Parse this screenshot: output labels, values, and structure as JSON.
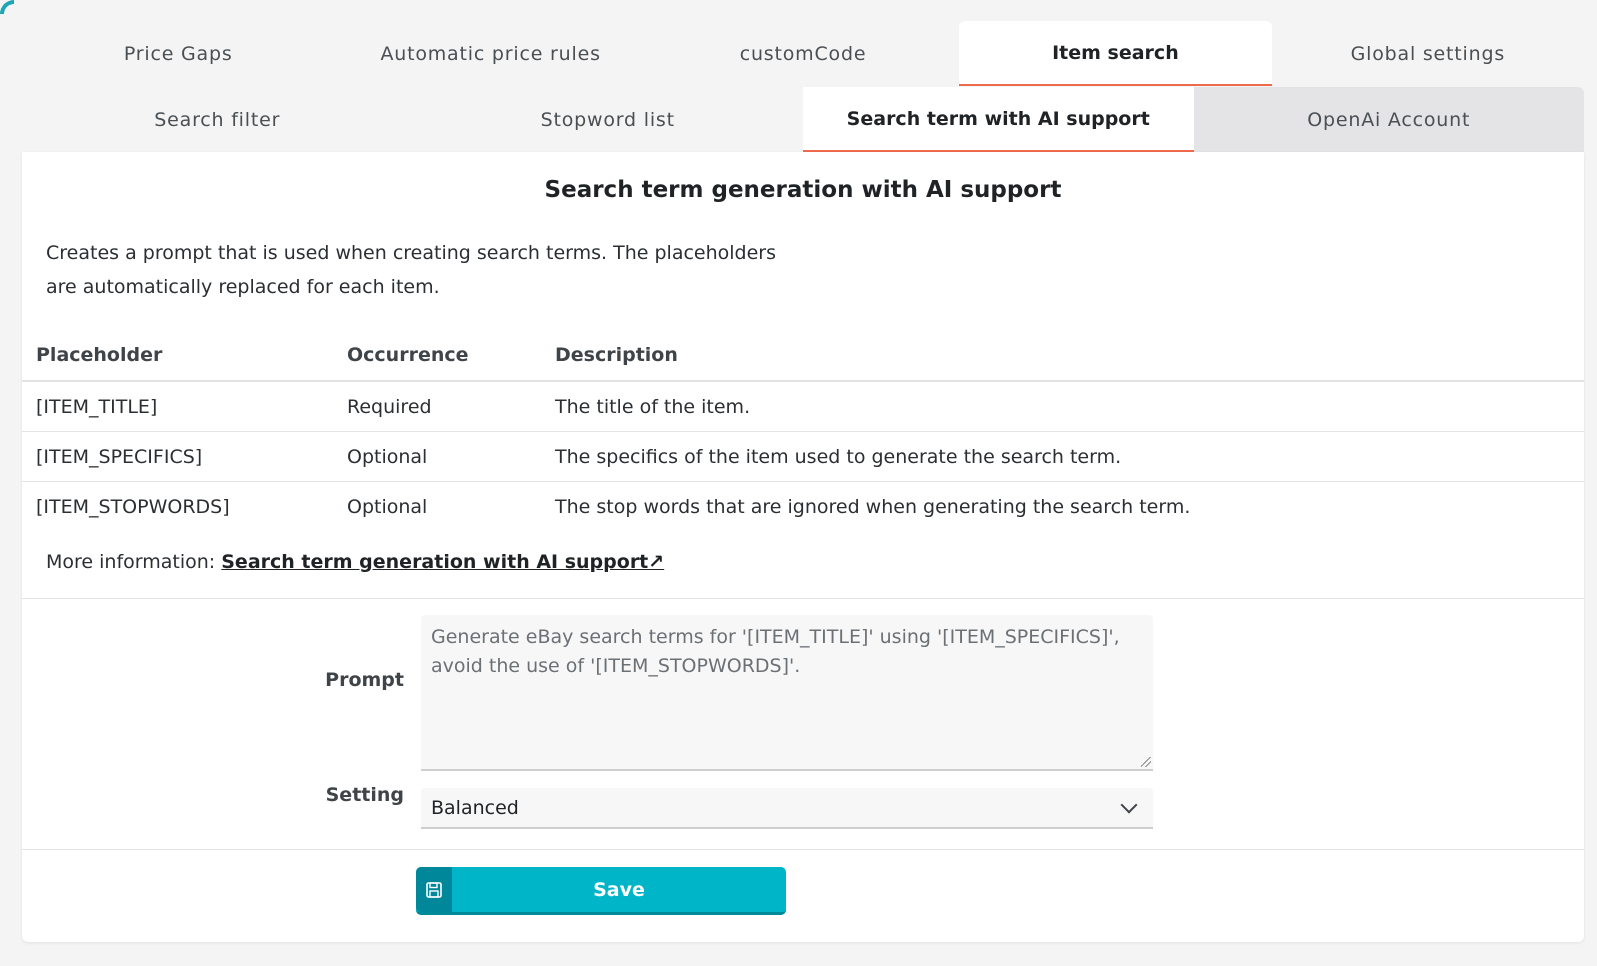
{
  "tabs_primary": [
    {
      "label": "Price Gaps",
      "active": false
    },
    {
      "label": "Automatic price rules",
      "active": false
    },
    {
      "label": "customCode",
      "active": false
    },
    {
      "label": "Item search",
      "active": true
    },
    {
      "label": "Global settings",
      "active": false
    }
  ],
  "tabs_secondary": [
    {
      "label": "Search filter",
      "active": false
    },
    {
      "label": "Stopword list",
      "active": false
    },
    {
      "label": "Search term with AI support",
      "active": true
    },
    {
      "label": "OpenAi Account",
      "active": false
    }
  ],
  "panel": {
    "heading": "Search term generation with AI support",
    "intro": "Creates a prompt that is used when creating search terms. The placeholders are automatically replaced for each item.",
    "table": {
      "headers": [
        "Placeholder",
        "Occurrence",
        "Description"
      ],
      "rows": [
        [
          "[ITEM_TITLE]",
          "Required",
          "The title of the item."
        ],
        [
          "[ITEM_SPECIFICS]",
          "Optional",
          "The specifics of the item used to generate the search term."
        ],
        [
          "[ITEM_STOPWORDS]",
          "Optional",
          "The stop words that are ignored when generating the search term."
        ]
      ]
    },
    "more_info_label": "More information:",
    "more_info_link": "Search term generation with AI support↗"
  },
  "form": {
    "prompt_label": "Prompt",
    "prompt_value": "Generate eBay search terms for '[ITEM_TITLE]' using '[ITEM_SPECIFICS]', avoid the use of '[ITEM_STOPWORDS]'.",
    "setting_label": "Setting",
    "setting_value": "Balanced",
    "save_label": "Save"
  },
  "colors": {
    "accent": "#ef6a4c",
    "button": "#00b5c8",
    "button_icon_bg": "#00879a"
  }
}
